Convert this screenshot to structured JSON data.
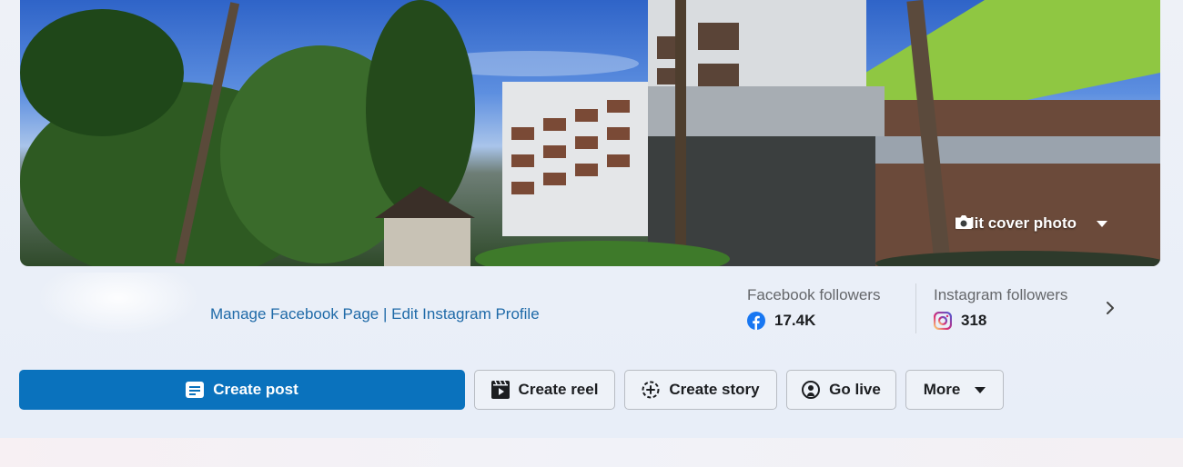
{
  "cover": {
    "edit_label": "Edit cover photo",
    "icons": {
      "camera": "camera-icon",
      "caret": "caret-down-icon"
    }
  },
  "profile": {
    "manage_fb_label": "Manage Facebook Page",
    "separator": "|",
    "edit_ig_label": "Edit Instagram Profile"
  },
  "stats": {
    "facebook": {
      "label": "Facebook followers",
      "value": "17.4K",
      "icon": "facebook-icon",
      "color": "#1877f2"
    },
    "instagram": {
      "label": "Instagram followers",
      "value": "318",
      "icon": "instagram-icon",
      "color": "#e1306c"
    }
  },
  "actions": {
    "create_post": "Create post",
    "create_reel": "Create reel",
    "create_story": "Create story",
    "go_live": "Go live",
    "more": "More"
  },
  "colors": {
    "primary": "#0a72bd",
    "link": "#1f6aa8"
  }
}
